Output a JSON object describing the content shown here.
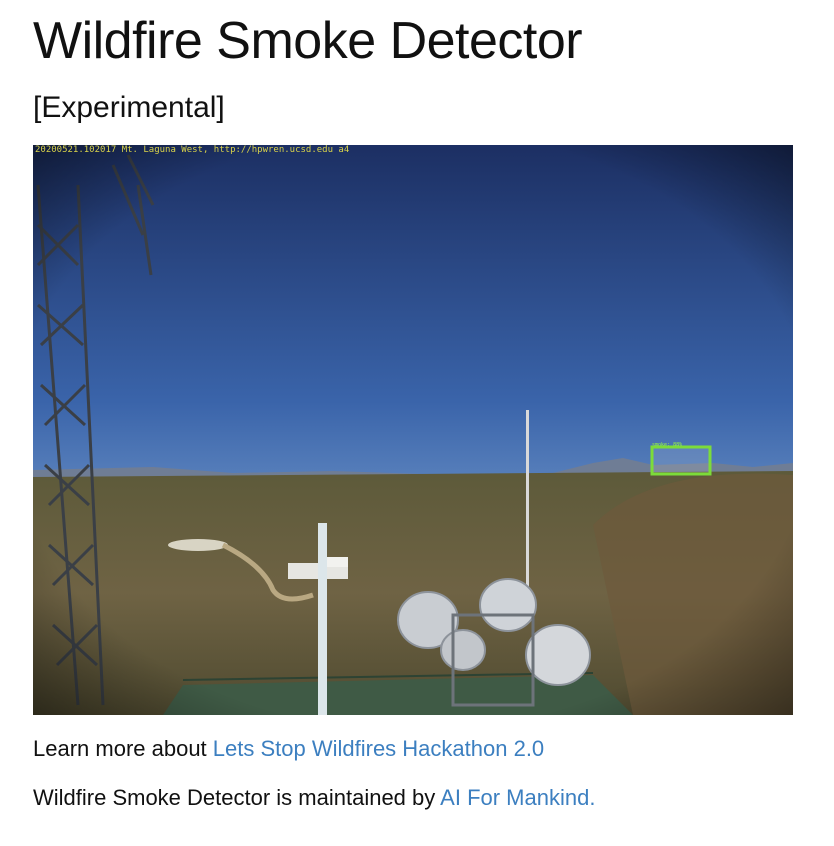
{
  "page": {
    "title": "Wildfire Smoke Detector",
    "subtitle": "[Experimental]"
  },
  "camera": {
    "caption": "20200521.102017 Mt. Laguna West, http://hpwren.ucsd.edu a4",
    "detection_label": "smoke: 88%",
    "detection_color": "#7cdc3a"
  },
  "footer": {
    "learn_prefix": "Learn more about ",
    "learn_link": "Lets Stop Wildfires Hackathon 2.0",
    "maintained_prefix": "Wildfire Smoke Detector is maintained by ",
    "maintained_link": "AI For Mankind."
  },
  "colors": {
    "link": "#3c7fc0",
    "text": "#111111"
  }
}
